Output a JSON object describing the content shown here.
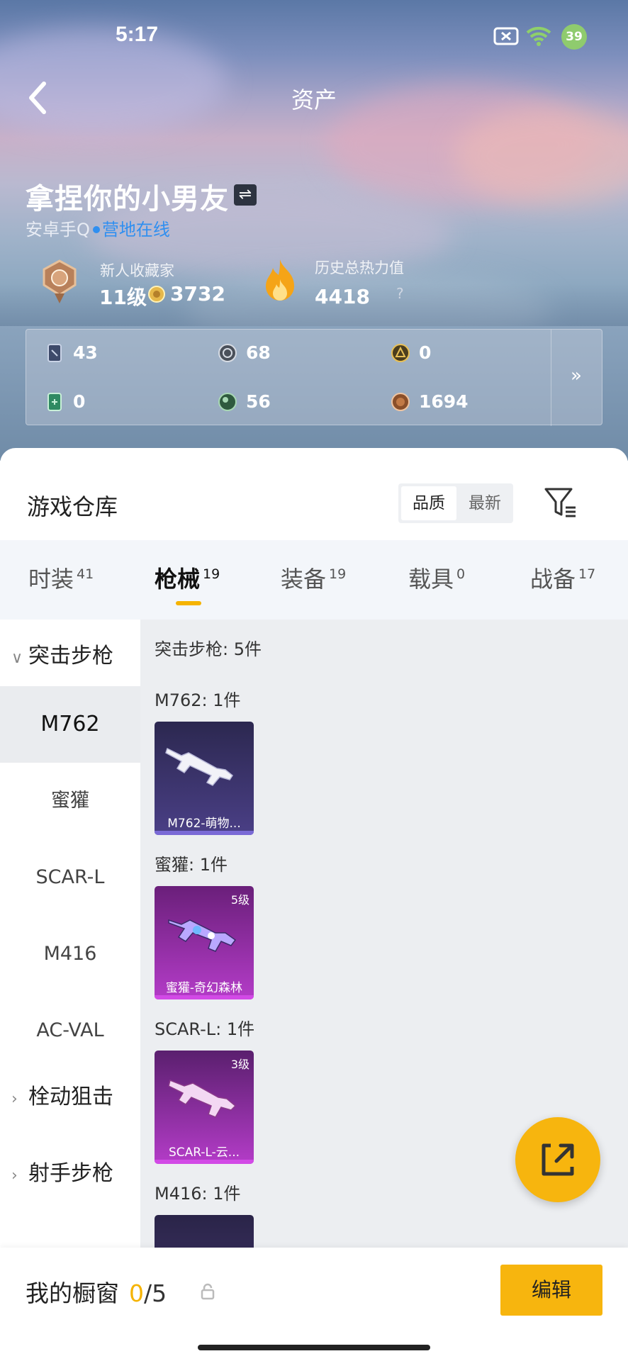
{
  "status_bar": {
    "time": "5:17",
    "battery": "39"
  },
  "header": {
    "title": "资产"
  },
  "profile": {
    "nickname": "拿捏你的小男友",
    "platform": "安卓手Q",
    "online_status": "营地在线",
    "collector_title": "新人收藏家",
    "level": "11级",
    "coins": "3732",
    "heat_title": "历史总热力值",
    "heat_value": "4418",
    "heat_help": "?"
  },
  "stats": [
    {
      "icon": "card-icon",
      "value": "43"
    },
    {
      "icon": "silver-coin-icon",
      "value": "68"
    },
    {
      "icon": "gold-coin-icon",
      "value": "0"
    },
    {
      "icon": "green-card-icon",
      "value": "0"
    },
    {
      "icon": "green-orb-icon",
      "value": "56"
    },
    {
      "icon": "bronze-coin-icon",
      "value": "1694"
    }
  ],
  "warehouse": {
    "title": "游戏仓库",
    "sort_options": [
      "品质",
      "最新"
    ],
    "tabs": [
      {
        "label": "时装",
        "count": "41"
      },
      {
        "label": "枪械",
        "count": "19"
      },
      {
        "label": "装备",
        "count": "19"
      },
      {
        "label": "载具",
        "count": "0"
      },
      {
        "label": "战备",
        "count": "17"
      }
    ],
    "sidebar": {
      "group_assault": "突击步枪",
      "items": [
        "M762",
        "蜜獾",
        "SCAR-L",
        "M416",
        "AC-VAL"
      ],
      "group_bolt": "栓动狙击",
      "group_dmr": "射手步枪"
    },
    "content": {
      "category_count": "突击步枪: 5件",
      "groups": [
        {
          "heading": "M762: 1件",
          "item_name": "M762-萌物...",
          "level": ""
        },
        {
          "heading": "蜜獾: 1件",
          "item_name": "蜜獾-奇幻森林",
          "level": "5级"
        },
        {
          "heading": "SCAR-L: 1件",
          "item_name": "SCAR-L-云...",
          "level": "3级"
        },
        {
          "heading": "M416: 1件",
          "item_name": "",
          "level": ""
        }
      ]
    }
  },
  "footer": {
    "label": "我的橱窗",
    "current": "0",
    "total": "/5",
    "edit_label": "编辑"
  },
  "colors": {
    "accent": "#f7b50e",
    "online": "#2f8ff0",
    "tab_underline": "#f5b300"
  }
}
